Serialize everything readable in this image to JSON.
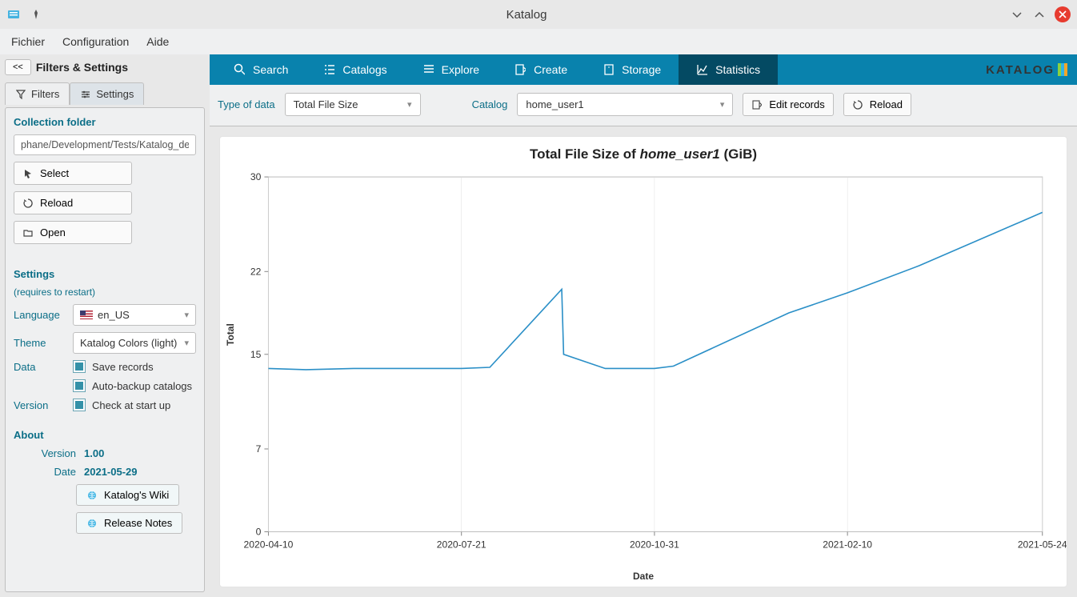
{
  "window": {
    "title": "Katalog"
  },
  "menubar": [
    "Fichier",
    "Configuration",
    "Aide"
  ],
  "sidebar": {
    "collapse": "<<",
    "title": "Filters & Settings",
    "tabs": {
      "filters": "Filters",
      "settings": "Settings"
    },
    "collection_head": "Collection folder",
    "collection_path": "phane/Development/Tests/Katalog_demo",
    "btn_select": "Select",
    "btn_reload": "Reload",
    "btn_open": "Open",
    "settings_head": "Settings",
    "settings_note": "(requires to restart)",
    "lang_label": "Language",
    "lang_value": "en_US",
    "theme_label": "Theme",
    "theme_value": "Katalog Colors (light)",
    "data_label": "Data",
    "chk_save": "Save records",
    "chk_backup": "Auto-backup catalogs",
    "version_label": "Version",
    "chk_start": "Check at start up",
    "about_head": "About",
    "about_version_label": "Version",
    "about_version_value": "1.00",
    "about_date_label": "Date",
    "about_date_value": "2021-05-29",
    "wiki_btn": "Katalog's Wiki",
    "release_btn": "Release Notes"
  },
  "maintabs": {
    "search": "Search",
    "catalogs": "Catalogs",
    "explore": "Explore",
    "create": "Create",
    "storage": "Storage",
    "statistics": "Statistics",
    "brand": "KATALOG"
  },
  "controls": {
    "type_label": "Type of data",
    "type_value": "Total File Size",
    "catalog_label": "Catalog",
    "catalog_value": "home_user1",
    "edit_btn": "Edit records",
    "reload_btn": "Reload"
  },
  "chart_data": {
    "type": "line",
    "title": "Total File Size of home_user1 (GiB)",
    "title_prefix": "Total File Size of ",
    "title_catalog": "home_user1",
    "title_suffix": " (GiB)",
    "xlabel": "Date",
    "ylabel": "Total",
    "x_ticks": [
      "2020-04-10",
      "2020-07-21",
      "2020-10-31",
      "2021-02-10",
      "2021-05-24"
    ],
    "y_ticks": [
      0,
      7,
      15,
      22,
      30
    ],
    "ylim": [
      0,
      30
    ],
    "series": [
      {
        "name": "Total File Size",
        "color": "#2a8fc7",
        "points": [
          {
            "x": "2020-04-10",
            "y": 13.8
          },
          {
            "x": "2020-04-30",
            "y": 13.7
          },
          {
            "x": "2020-05-25",
            "y": 13.8
          },
          {
            "x": "2020-06-20",
            "y": 13.8
          },
          {
            "x": "2020-07-21",
            "y": 13.8
          },
          {
            "x": "2020-08-05",
            "y": 13.9
          },
          {
            "x": "2020-09-12",
            "y": 20.5
          },
          {
            "x": "2020-09-13",
            "y": 15.0
          },
          {
            "x": "2020-10-05",
            "y": 13.8
          },
          {
            "x": "2020-10-31",
            "y": 13.8
          },
          {
            "x": "2020-11-10",
            "y": 14.0
          },
          {
            "x": "2021-01-10",
            "y": 18.5
          },
          {
            "x": "2021-02-10",
            "y": 20.2
          },
          {
            "x": "2021-03-20",
            "y": 22.5
          },
          {
            "x": "2021-05-24",
            "y": 27.0
          }
        ]
      }
    ]
  }
}
